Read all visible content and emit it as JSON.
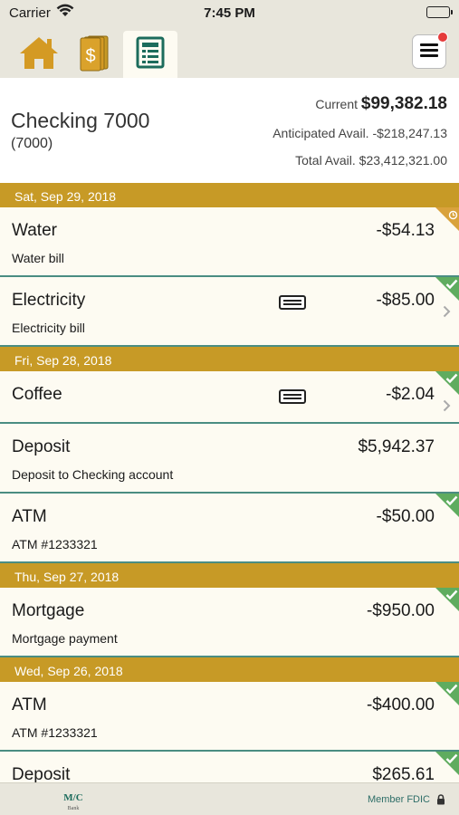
{
  "status_bar": {
    "carrier": "Carrier",
    "time": "7:45 PM"
  },
  "nav": {
    "tabs": [
      {
        "icon": "home-icon",
        "active": false
      },
      {
        "icon": "money-icon",
        "active": false
      },
      {
        "icon": "register-icon",
        "active": true
      }
    ],
    "menu_icon": "menu-icon",
    "notification_color": "#e53b3b"
  },
  "account": {
    "name": "Checking 7000",
    "number": "(7000)",
    "current_label": "Current",
    "current_value": "$99,382.18",
    "anticipated_label": "Anticipated Avail.",
    "anticipated_value": "-$218,247.13",
    "total_label": "Total Avail.",
    "total_value": "$23,412,321.00"
  },
  "colors": {
    "accent": "#c79a26",
    "divider": "#4a8d82",
    "cleared": "#5fac5f",
    "pending": "#d9a23c"
  },
  "groups": [
    {
      "date": "Sat, Sep 29, 2018",
      "transactions": [
        {
          "title": "Water",
          "amount": "-$54.13",
          "desc": "Water bill",
          "status": "pending",
          "card": false,
          "chevron": false
        },
        {
          "title": "Electricity",
          "amount": "-$85.00",
          "desc": "Electricity bill",
          "status": "cleared",
          "card": true,
          "chevron": true
        }
      ]
    },
    {
      "date": "Fri, Sep 28, 2018",
      "transactions": [
        {
          "title": "Coffee",
          "amount": "-$2.04",
          "desc": "",
          "status": "cleared",
          "card": true,
          "chevron": true
        },
        {
          "title": "Deposit",
          "amount": "$5,942.37",
          "desc": "Deposit to Checking account",
          "status": "none",
          "card": false,
          "chevron": false
        },
        {
          "title": "ATM",
          "amount": "-$50.00",
          "desc": "ATM #1233321",
          "status": "cleared",
          "card": false,
          "chevron": false
        }
      ]
    },
    {
      "date": "Thu, Sep 27, 2018",
      "transactions": [
        {
          "title": "Mortgage",
          "amount": "-$950.00",
          "desc": "Mortgage payment",
          "status": "cleared",
          "card": false,
          "chevron": false
        }
      ]
    },
    {
      "date": "Wed, Sep 26, 2018",
      "transactions": [
        {
          "title": "ATM",
          "amount": "-$400.00",
          "desc": "ATM #1233321",
          "status": "cleared",
          "card": false,
          "chevron": false
        },
        {
          "title": "Deposit",
          "amount": "$265.61",
          "desc": "",
          "status": "cleared",
          "card": false,
          "chevron": false
        }
      ]
    }
  ],
  "footer": {
    "logo_text": "M/C",
    "logo_sub": "Bank",
    "fdic": "Member FDIC",
    "lock_icon": "lock-icon"
  }
}
